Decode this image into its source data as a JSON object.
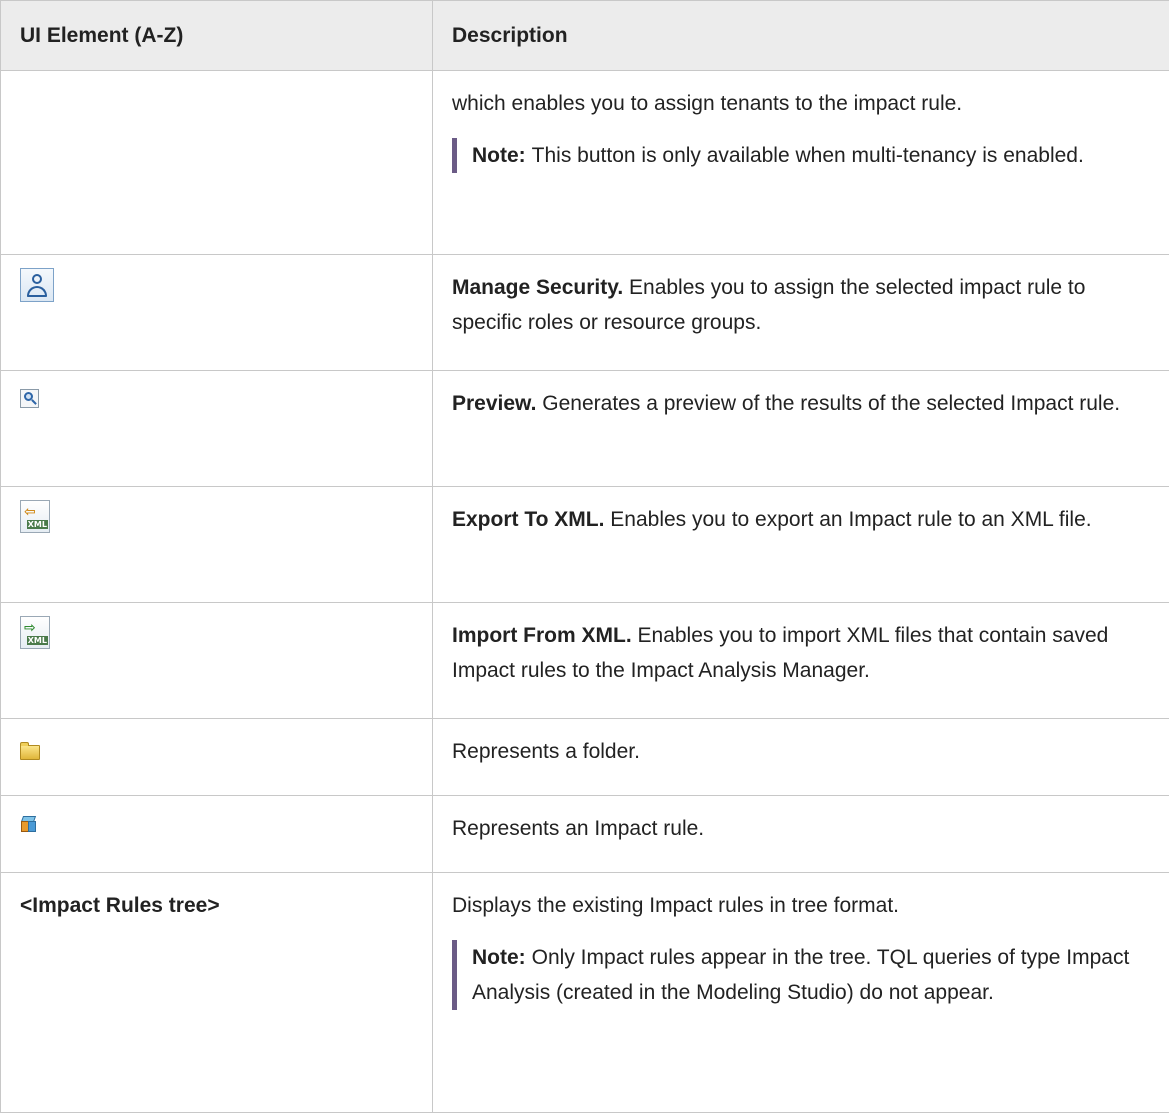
{
  "table": {
    "headers": [
      "UI Element (A-Z)",
      "Description"
    ],
    "continuation": {
      "text": "which enables you to assign tenants to the impact rule.",
      "note_label": "Note:",
      "note_text": "This button is only available when multi-tenancy is enabled."
    },
    "rows": [
      {
        "icon": "manage-security-icon",
        "title": "Manage Security.",
        "text": "Enables you to assign the selected impact rule to specific roles or resource groups."
      },
      {
        "icon": "preview-icon",
        "title": "Preview.",
        "text": "Generates a preview of the results of the selected Impact rule."
      },
      {
        "icon": "export-to-xml-icon",
        "title": "Export To XML.",
        "text": "Enables you to export an Impact rule to an XML file."
      },
      {
        "icon": "import-from-xml-icon",
        "title": "Import From XML.",
        "text": "Enables you to import XML files that contain saved Impact rules to the Impact Analysis Manager."
      },
      {
        "icon": "folder-icon",
        "text": "Represents a folder."
      },
      {
        "icon": "impact-rule-icon",
        "text": "Represents an Impact rule."
      }
    ],
    "tree_row": {
      "name": "<Impact Rules tree>",
      "text": "Displays the existing Impact rules in tree format.",
      "note_label": "Note:",
      "note_text": "Only Impact rules appear in the tree. TQL queries of type Impact Analysis (created in the Modeling Studio) do not appear."
    },
    "icon_labels": {
      "export": "⇦",
      "import": "⇨",
      "xml_tag": "XML"
    }
  }
}
